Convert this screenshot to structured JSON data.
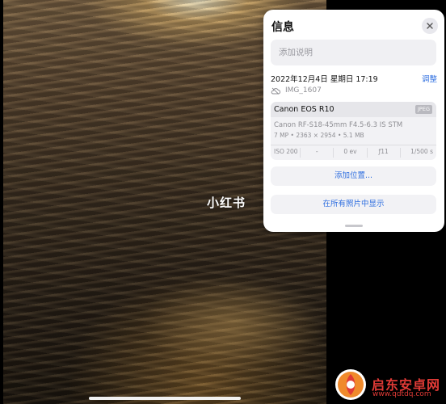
{
  "photo": {
    "watermark": "小红书"
  },
  "info_panel": {
    "title": "信息",
    "caption_placeholder": "添加说明",
    "datetime": "2022年12月4日 星期日 17:19",
    "adjust_label": "调整",
    "filename": "IMG_1607",
    "camera": {
      "model": "Canon EOS R10",
      "format": "JPEG",
      "lens": "Canon RF-S18-45mm F4.5-6.3 IS STM",
      "specs": "7 MP  •  2363 × 2954  •  5.1 MB",
      "exif": {
        "iso": "ISO 200",
        "focal": "-",
        "ev": "0 ev",
        "aperture": "ƒ11",
        "shutter": "1/500 s"
      }
    },
    "add_location_label": "添加位置...",
    "show_all_label": "在所有照片中显示"
  },
  "site_watermark": {
    "name": "启东安卓网",
    "url": "www.qdtdq.com"
  },
  "colors": {
    "accent": "#2f6fe0",
    "brand": "#e03a36"
  }
}
